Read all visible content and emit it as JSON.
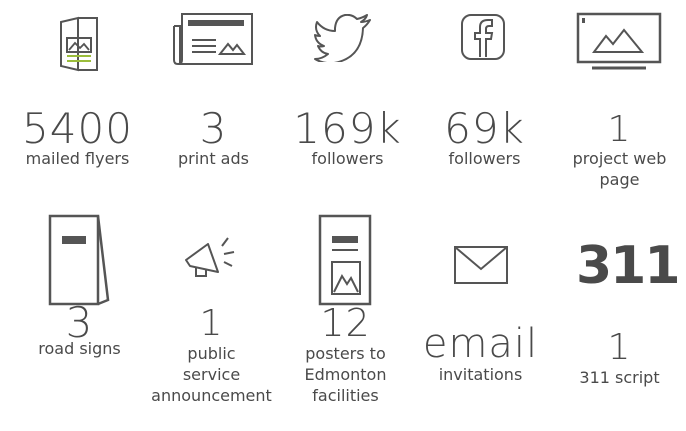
{
  "stats": [
    {
      "number": "5400",
      "label": "mailed flyers",
      "icon": "flyer-icon"
    },
    {
      "number": "3",
      "label": "print ads",
      "icon": "newspaper-icon"
    },
    {
      "number": "169k",
      "label": "followers",
      "icon": "twitter-icon"
    },
    {
      "number": "69k",
      "label": "followers",
      "icon": "facebook-icon"
    },
    {
      "number": "1",
      "label_lines": [
        "project web",
        "page"
      ],
      "icon": "monitor-icon"
    },
    {
      "number": "3",
      "label": "road signs",
      "icon": "road-sign-icon"
    },
    {
      "number": "1",
      "label_lines": [
        "public",
        "service",
        "announcement"
      ],
      "icon": "megaphone-icon"
    },
    {
      "number": "12",
      "label_lines": [
        "posters to",
        "Edmonton",
        "facilities"
      ],
      "icon": "poster-icon"
    },
    {
      "number": "email",
      "label": "invitations",
      "icon": "envelope-icon"
    },
    {
      "number": "1",
      "label": "311 script",
      "icon": "311-logo",
      "logo_text": "311"
    }
  ],
  "colors": {
    "icon_stroke": "#555555",
    "text": "#4a4a4a",
    "accent": "#9bbd3b"
  }
}
